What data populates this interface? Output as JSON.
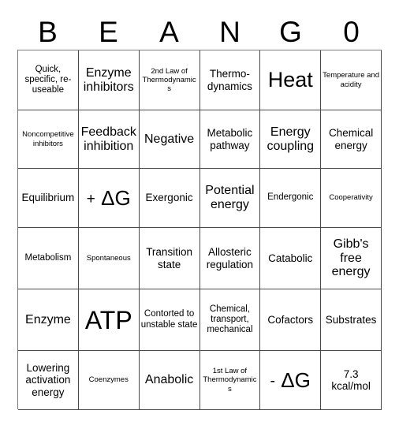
{
  "card": {
    "title": "BEANGO bingo card",
    "header_letters": [
      "B",
      "E",
      "A",
      "N",
      "G",
      "0"
    ],
    "grid_size": {
      "columns": 6,
      "rows": 6
    },
    "colors": {
      "background": "#ffffff",
      "text": "#000000",
      "grid_line": "#4a4a4a"
    },
    "cells": [
      {
        "text": "Quick, specific, re-useable",
        "size": "s"
      },
      {
        "text": "Enzyme inhibitors",
        "size": "l"
      },
      {
        "text": "2nd Law of Thermodynamics",
        "size": "xs"
      },
      {
        "text": "Thermo-dynamics",
        "size": "m"
      },
      {
        "text": "Heat",
        "size": "xxl"
      },
      {
        "text": "Temperature and acidity",
        "size": "xs"
      },
      {
        "text": "Noncompetitive inhibitors",
        "size": "xs"
      },
      {
        "text": "Feedback inhibition",
        "size": "l"
      },
      {
        "text": "Negative",
        "size": "l"
      },
      {
        "text": "Metabolic pathway",
        "size": "m"
      },
      {
        "text": "Energy coupling",
        "size": "l"
      },
      {
        "text": "Chemical energy",
        "size": "m"
      },
      {
        "text": "Equilibrium",
        "size": "m"
      },
      {
        "text": "+ ΔG",
        "size": "dg"
      },
      {
        "text": "Exergonic",
        "size": "m"
      },
      {
        "text": "Potential energy",
        "size": "l"
      },
      {
        "text": "Endergonic",
        "size": "s"
      },
      {
        "text": "Cooperativity",
        "size": "xs"
      },
      {
        "text": "Metabolism",
        "size": "s"
      },
      {
        "text": "Spontaneous",
        "size": "xs"
      },
      {
        "text": "Transition state",
        "size": "m"
      },
      {
        "text": "Allosteric regulation",
        "size": "m"
      },
      {
        "text": "Catabolic",
        "size": "m"
      },
      {
        "text": "Gibb's free energy",
        "size": "l"
      },
      {
        "text": "Enzyme",
        "size": "l"
      },
      {
        "text": "ATP",
        "size": "huge"
      },
      {
        "text": "Contorted to unstable state",
        "size": "s"
      },
      {
        "text": "Chemical, transport, mechanical",
        "size": "s"
      },
      {
        "text": "Cofactors",
        "size": "m"
      },
      {
        "text": "Substrates",
        "size": "m"
      },
      {
        "text": "Lowering activation energy",
        "size": "m"
      },
      {
        "text": "Coenzymes",
        "size": "xs"
      },
      {
        "text": "Anabolic",
        "size": "l"
      },
      {
        "text": "1st Law of Thermodynamics",
        "size": "xs"
      },
      {
        "text": "- ΔG",
        "size": "dg"
      },
      {
        "text": "7.3 kcal/mol",
        "size": "m"
      }
    ]
  }
}
